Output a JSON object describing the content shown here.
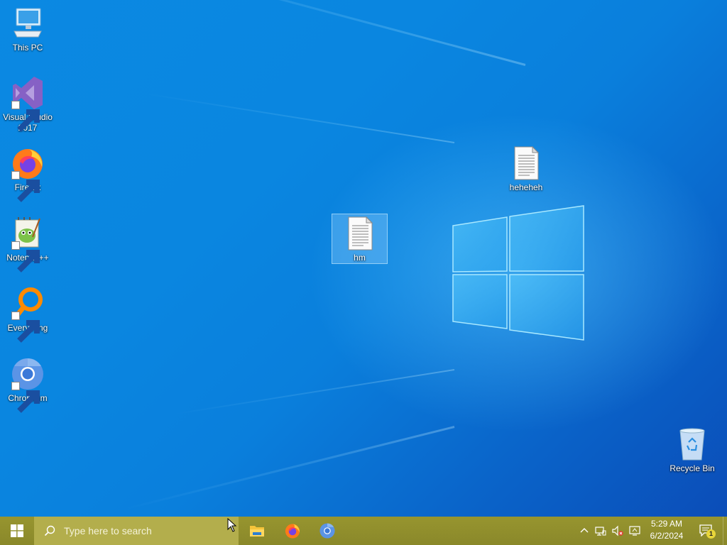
{
  "desktop": {
    "icons": {
      "this_pc": {
        "label": "This PC",
        "icon": "computer-icon"
      },
      "visual_studio": {
        "label": "Visual Studio 2017",
        "icon": "visual-studio-icon"
      },
      "firefox": {
        "label": "Firefox",
        "icon": "firefox-icon"
      },
      "notepadpp": {
        "label": "Notepad++",
        "icon": "notepadpp-icon"
      },
      "everything": {
        "label": "Everything",
        "icon": "everything-search-icon"
      },
      "chromium": {
        "label": "Chromium",
        "icon": "chromium-icon"
      },
      "heheheh": {
        "label": "heheheh",
        "icon": "text-file-icon"
      },
      "hm": {
        "label": "hm",
        "icon": "text-file-icon",
        "selected": true
      },
      "recycle_bin": {
        "label": "Recycle Bin",
        "icon": "recycle-bin-icon"
      }
    },
    "wallpaper": "windows-10-hero-blue"
  },
  "taskbar": {
    "start_icon": "windows-start-icon",
    "search": {
      "placeholder": "Type here to search",
      "icon": "search-icon"
    },
    "pinned_apps": [
      {
        "name": "File Explorer",
        "icon": "file-explorer-icon"
      },
      {
        "name": "Firefox",
        "icon": "firefox-icon"
      },
      {
        "name": "Chromium",
        "icon": "chromium-icon"
      }
    ],
    "tray": {
      "icons": [
        "chevron-up-icon",
        "network-icon",
        "volume-muted-icon",
        "display-icon"
      ],
      "time": "5:29 AM",
      "date": "6/2/2024",
      "notification_count": "1"
    },
    "colors": {
      "bar": "#8c8a2d",
      "search": "#b3ae4c"
    }
  }
}
